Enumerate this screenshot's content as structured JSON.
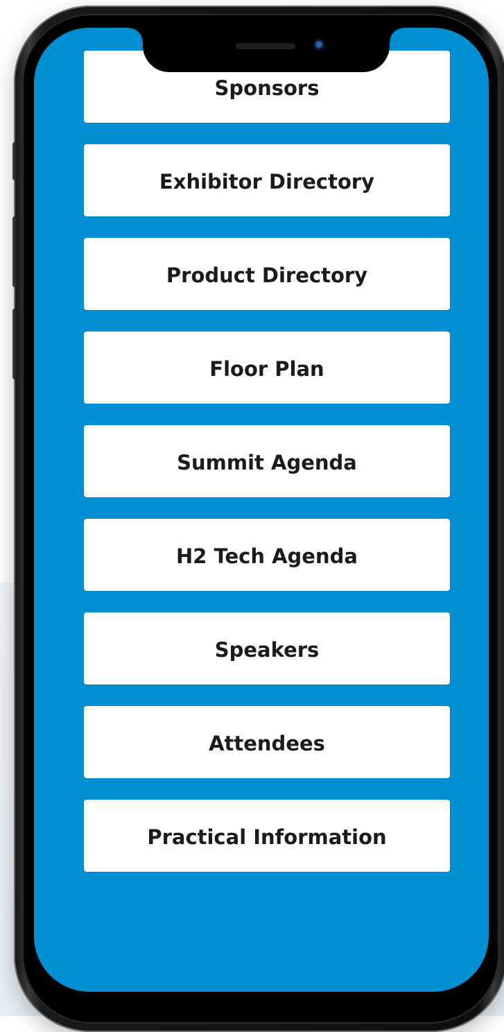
{
  "theme": {
    "screen_color": "#018fd3",
    "button_color": "#ffffff",
    "text_color": "#1b1b1b"
  },
  "menu": {
    "items": [
      {
        "label": "Sponsors"
      },
      {
        "label": "Exhibitor Directory"
      },
      {
        "label": "Product Directory"
      },
      {
        "label": "Floor Plan"
      },
      {
        "label": "Summit Agenda"
      },
      {
        "label": "H2 Tech Agenda"
      },
      {
        "label": "Speakers"
      },
      {
        "label": "Attendees"
      },
      {
        "label": "Practical Information"
      }
    ]
  }
}
